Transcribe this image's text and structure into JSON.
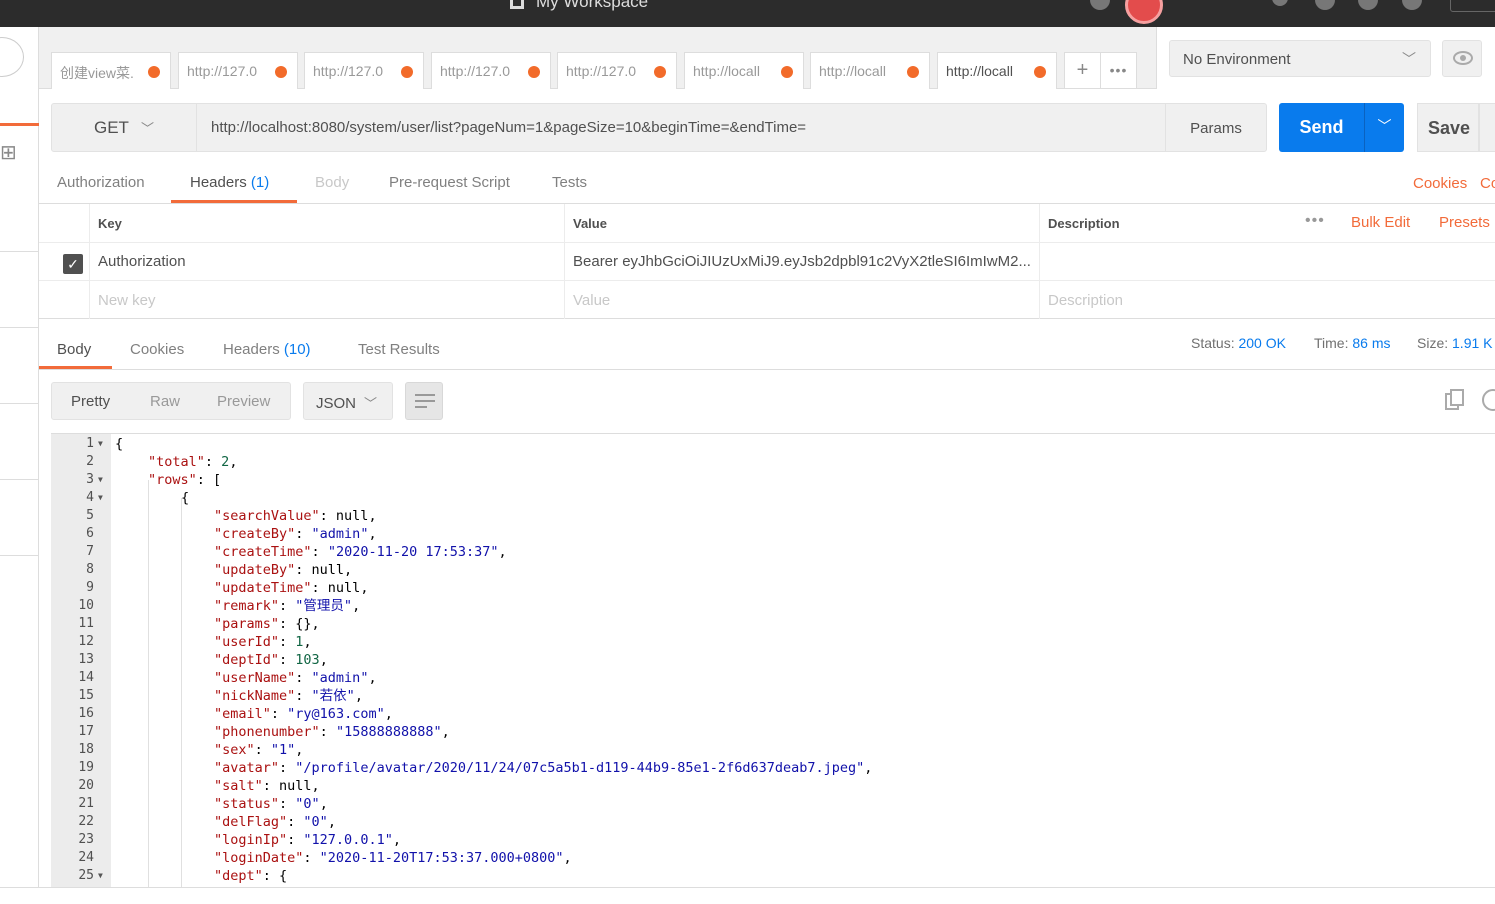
{
  "topbar": {
    "workspace": "My Workspace"
  },
  "tabs": [
    "创建view菜.",
    "http://127.0",
    "http://127.0",
    "http://127.0",
    "http://127.0",
    "http://locall",
    "http://locall",
    "http://locall"
  ],
  "environment": {
    "selected": "No Environment"
  },
  "request": {
    "method": "GET",
    "url": "http://localhost:8080/system/user/list?pageNum=1&pageSize=10&beginTime=&endTime=",
    "params_label": "Params",
    "send_label": "Send",
    "save_label": "Save"
  },
  "req_tabs": {
    "authorization": "Authorization",
    "headers": "Headers",
    "headers_count": "(1)",
    "body": "Body",
    "prerequest": "Pre-request Script",
    "tests": "Tests",
    "cookies": "Cookies",
    "code": "Co"
  },
  "headers_table": {
    "columns": {
      "key": "Key",
      "value": "Value",
      "description": "Description"
    },
    "bulk_edit": "Bulk Edit",
    "presets": "Presets",
    "row": {
      "key": "Authorization",
      "value": "Bearer eyJhbGciOiJIUzUxMiJ9.eyJsb2dpbl91c2VyX2tleSI6ImIwM2..."
    },
    "placeholders": {
      "key": "New key",
      "value": "Value",
      "description": "Description"
    }
  },
  "response": {
    "tabs": {
      "body": "Body",
      "cookies": "Cookies",
      "headers": "Headers",
      "headers_count": "(10)",
      "test_results": "Test Results"
    },
    "status_label": "Status:",
    "status": "200 OK",
    "time_label": "Time:",
    "time": "86 ms",
    "size_label": "Size:",
    "size": "1.91 K",
    "views": {
      "pretty": "Pretty",
      "raw": "Raw",
      "preview": "Preview",
      "format": "JSON"
    }
  },
  "code_lines": [
    {
      "n": "1",
      "fold": true,
      "i": 0,
      "t": [
        [
          "p",
          "{"
        ]
      ]
    },
    {
      "n": "2",
      "i": 1,
      "t": [
        [
          "k",
          "\"total\""
        ],
        [
          "p",
          ": "
        ],
        [
          "n",
          "2"
        ],
        [
          "p",
          ","
        ]
      ]
    },
    {
      "n": "3",
      "fold": true,
      "i": 1,
      "t": [
        [
          "k",
          "\"rows\""
        ],
        [
          "p",
          ": ["
        ]
      ]
    },
    {
      "n": "4",
      "fold": true,
      "i": 2,
      "t": [
        [
          "p",
          "{"
        ]
      ]
    },
    {
      "n": "5",
      "i": 3,
      "t": [
        [
          "k",
          "\"searchValue\""
        ],
        [
          "p",
          ": null,"
        ]
      ]
    },
    {
      "n": "6",
      "i": 3,
      "t": [
        [
          "k",
          "\"createBy\""
        ],
        [
          "p",
          ": "
        ],
        [
          "s",
          "\"admin\""
        ],
        [
          "p",
          ","
        ]
      ]
    },
    {
      "n": "7",
      "i": 3,
      "t": [
        [
          "k",
          "\"createTime\""
        ],
        [
          "p",
          ": "
        ],
        [
          "s",
          "\"2020-11-20 17:53:37\""
        ],
        [
          "p",
          ","
        ]
      ]
    },
    {
      "n": "8",
      "i": 3,
      "t": [
        [
          "k",
          "\"updateBy\""
        ],
        [
          "p",
          ": null,"
        ]
      ]
    },
    {
      "n": "9",
      "i": 3,
      "t": [
        [
          "k",
          "\"updateTime\""
        ],
        [
          "p",
          ": null,"
        ]
      ]
    },
    {
      "n": "10",
      "i": 3,
      "t": [
        [
          "k",
          "\"remark\""
        ],
        [
          "p",
          ": "
        ],
        [
          "s",
          "\"管理员\""
        ],
        [
          "p",
          ","
        ]
      ]
    },
    {
      "n": "11",
      "i": 3,
      "t": [
        [
          "k",
          "\"params\""
        ],
        [
          "p",
          ": {},"
        ]
      ]
    },
    {
      "n": "12",
      "i": 3,
      "t": [
        [
          "k",
          "\"userId\""
        ],
        [
          "p",
          ": "
        ],
        [
          "n",
          "1"
        ],
        [
          "p",
          ","
        ]
      ]
    },
    {
      "n": "13",
      "i": 3,
      "t": [
        [
          "k",
          "\"deptId\""
        ],
        [
          "p",
          ": "
        ],
        [
          "n",
          "103"
        ],
        [
          "p",
          ","
        ]
      ]
    },
    {
      "n": "14",
      "i": 3,
      "t": [
        [
          "k",
          "\"userName\""
        ],
        [
          "p",
          ": "
        ],
        [
          "s",
          "\"admin\""
        ],
        [
          "p",
          ","
        ]
      ]
    },
    {
      "n": "15",
      "i": 3,
      "t": [
        [
          "k",
          "\"nickName\""
        ],
        [
          "p",
          ": "
        ],
        [
          "s",
          "\"若依\""
        ],
        [
          "p",
          ","
        ]
      ]
    },
    {
      "n": "16",
      "i": 3,
      "t": [
        [
          "k",
          "\"email\""
        ],
        [
          "p",
          ": "
        ],
        [
          "s",
          "\"ry@163.com\""
        ],
        [
          "p",
          ","
        ]
      ]
    },
    {
      "n": "17",
      "i": 3,
      "t": [
        [
          "k",
          "\"phonenumber\""
        ],
        [
          "p",
          ": "
        ],
        [
          "s",
          "\"15888888888\""
        ],
        [
          "p",
          ","
        ]
      ]
    },
    {
      "n": "18",
      "i": 3,
      "t": [
        [
          "k",
          "\"sex\""
        ],
        [
          "p",
          ": "
        ],
        [
          "s",
          "\"1\""
        ],
        [
          "p",
          ","
        ]
      ]
    },
    {
      "n": "19",
      "i": 3,
      "t": [
        [
          "k",
          "\"avatar\""
        ],
        [
          "p",
          ": "
        ],
        [
          "s",
          "\"/profile/avatar/2020/11/24/07c5a5b1-d119-44b9-85e1-2f6d637deab7.jpeg\""
        ],
        [
          "p",
          ","
        ]
      ]
    },
    {
      "n": "20",
      "i": 3,
      "t": [
        [
          "k",
          "\"salt\""
        ],
        [
          "p",
          ": null,"
        ]
      ]
    },
    {
      "n": "21",
      "i": 3,
      "t": [
        [
          "k",
          "\"status\""
        ],
        [
          "p",
          ": "
        ],
        [
          "s",
          "\"0\""
        ],
        [
          "p",
          ","
        ]
      ]
    },
    {
      "n": "22",
      "i": 3,
      "t": [
        [
          "k",
          "\"delFlag\""
        ],
        [
          "p",
          ": "
        ],
        [
          "s",
          "\"0\""
        ],
        [
          "p",
          ","
        ]
      ]
    },
    {
      "n": "23",
      "i": 3,
      "t": [
        [
          "k",
          "\"loginIp\""
        ],
        [
          "p",
          ": "
        ],
        [
          "s",
          "\"127.0.0.1\""
        ],
        [
          "p",
          ","
        ]
      ]
    },
    {
      "n": "24",
      "i": 3,
      "t": [
        [
          "k",
          "\"loginDate\""
        ],
        [
          "p",
          ": "
        ],
        [
          "s",
          "\"2020-11-20T17:53:37.000+0800\""
        ],
        [
          "p",
          ","
        ]
      ]
    },
    {
      "n": "25",
      "fold": true,
      "i": 3,
      "t": [
        [
          "k",
          "\"dept\""
        ],
        [
          "p",
          ": {"
        ]
      ]
    }
  ]
}
